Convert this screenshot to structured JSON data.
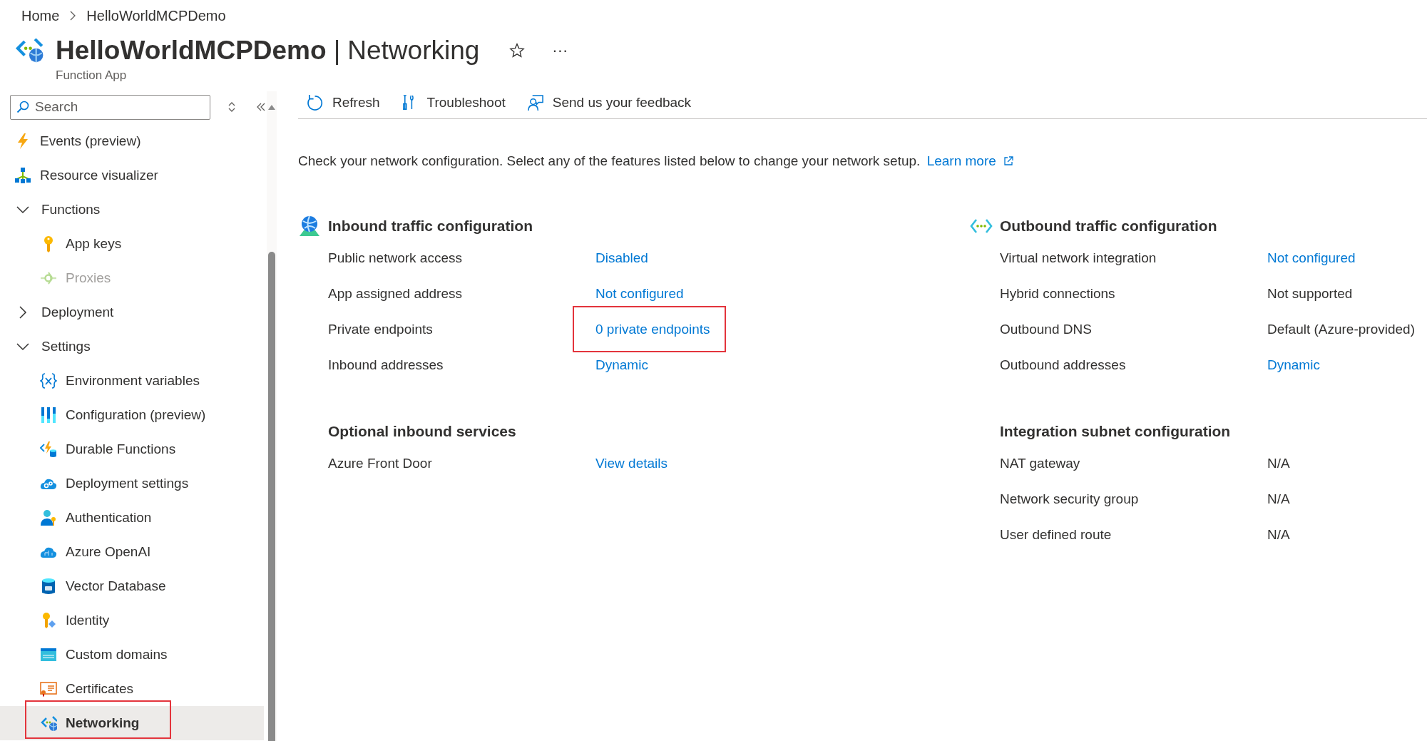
{
  "breadcrumb": [
    {
      "label": "Home"
    },
    {
      "label": "HelloWorldMCPDemo"
    }
  ],
  "header": {
    "resource": "HelloWorldMCPDemo",
    "separator": "|",
    "page": "Networking",
    "subtitle": "Function App",
    "favorite": false,
    "more": "···"
  },
  "sidebar": {
    "search_placeholder": "Search",
    "items": [
      {
        "label": "Events (preview)",
        "selected": false
      },
      {
        "label": "Resource visualizer",
        "selected": false
      },
      {
        "label": "Functions",
        "selected": false,
        "expanded": true,
        "children": [
          {
            "label": "App keys",
            "selected": false,
            "disabled": false
          },
          {
            "label": "Proxies",
            "selected": false,
            "disabled": true
          }
        ]
      },
      {
        "label": "Deployment",
        "selected": false,
        "expanded": false
      },
      {
        "label": "Settings",
        "selected": false,
        "expanded": true,
        "children": [
          {
            "label": "Environment variables",
            "selected": false,
            "highlighted": false
          },
          {
            "label": "Configuration (preview)",
            "selected": false,
            "highlighted": false
          },
          {
            "label": "Durable Functions",
            "selected": false,
            "highlighted": false
          },
          {
            "label": "Deployment settings",
            "selected": false,
            "highlighted": false
          },
          {
            "label": "Authentication",
            "selected": false,
            "highlighted": false
          },
          {
            "label": "Azure OpenAI",
            "selected": false,
            "highlighted": false
          },
          {
            "label": "Vector Database",
            "selected": false,
            "highlighted": false
          },
          {
            "label": "Identity",
            "selected": false,
            "highlighted": false
          },
          {
            "label": "Custom domains",
            "selected": false,
            "highlighted": false
          },
          {
            "label": "Certificates",
            "selected": false,
            "highlighted": false
          },
          {
            "label": "Networking",
            "selected": true,
            "highlighted": true
          }
        ]
      }
    ]
  },
  "toolbar": [
    {
      "label": "Refresh"
    },
    {
      "label": "Troubleshoot"
    },
    {
      "label": "Send us your feedback"
    }
  ],
  "intro": {
    "text": "Check your network configuration. Select any of the features listed below to change your network setup.",
    "link": "Learn more"
  },
  "inbound": {
    "title": "Inbound traffic configuration",
    "rows": [
      {
        "label": "Public network access",
        "value": "Disabled",
        "link": true,
        "highlighted": false
      },
      {
        "label": "App assigned address",
        "value": "Not configured",
        "link": true,
        "highlighted": false
      },
      {
        "label": "Private endpoints",
        "value": "0 private endpoints",
        "link": true,
        "highlighted": true
      },
      {
        "label": "Inbound addresses",
        "value": "Dynamic",
        "link": true,
        "highlighted": false
      }
    ]
  },
  "optional_inbound": {
    "title": "Optional inbound services",
    "rows": [
      {
        "label": "Azure Front Door",
        "value": "View details",
        "link": true
      }
    ]
  },
  "outbound": {
    "title": "Outbound traffic configuration",
    "rows": [
      {
        "label": "Virtual network integration",
        "value": "Not configured",
        "link": true
      },
      {
        "label": "Hybrid connections",
        "value": "Not supported",
        "link": false
      },
      {
        "label": "Outbound DNS",
        "value": "Default (Azure-provided)",
        "link": false
      },
      {
        "label": "Outbound addresses",
        "value": "Dynamic",
        "link": true
      }
    ]
  },
  "integration_subnet": {
    "title": "Integration subnet configuration",
    "rows": [
      {
        "label": "NAT gateway",
        "value": "N/A",
        "link": false
      },
      {
        "label": "Network security group",
        "value": "N/A",
        "link": false
      },
      {
        "label": "User defined route",
        "value": "N/A",
        "link": false
      }
    ]
  }
}
